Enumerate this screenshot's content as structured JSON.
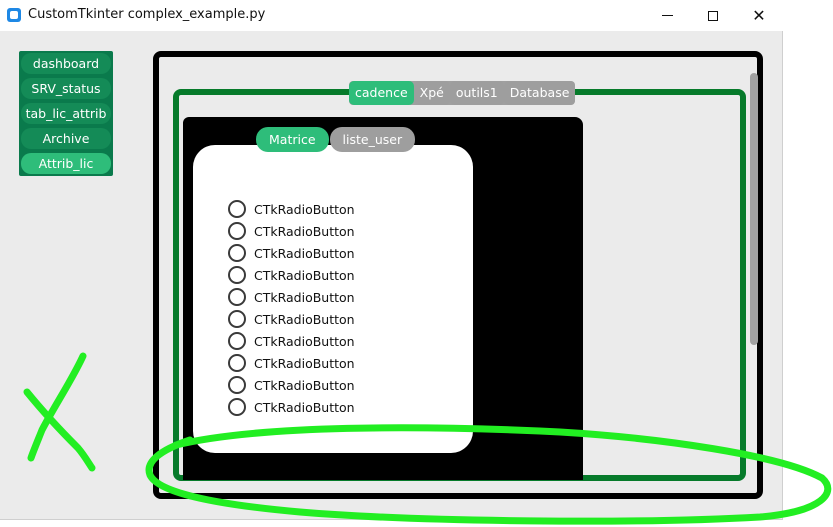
{
  "window": {
    "title": "CustomTkinter complex_example.py"
  },
  "sidebar": {
    "items": [
      {
        "label": "dashboard",
        "active": false
      },
      {
        "label": "SRV_status",
        "active": false
      },
      {
        "label": "tab_lic_attrib",
        "active": false
      },
      {
        "label": "Archive",
        "active": false
      },
      {
        "label": "Attrib_lic",
        "active": true
      }
    ]
  },
  "main_tabs": [
    {
      "label": "cadence",
      "active": true
    },
    {
      "label": "Xpé",
      "active": false
    },
    {
      "label": "outils1",
      "active": false
    },
    {
      "label": "Database",
      "active": false
    }
  ],
  "sub_tabs": [
    {
      "label": "Matrice",
      "active": true
    },
    {
      "label": "liste_user",
      "active": false
    }
  ],
  "radio_buttons": [
    {
      "label": "CTkRadioButton"
    },
    {
      "label": "CTkRadioButton"
    },
    {
      "label": "CTkRadioButton"
    },
    {
      "label": "CTkRadioButton"
    },
    {
      "label": "CTkRadioButton"
    },
    {
      "label": "CTkRadioButton"
    },
    {
      "label": "CTkRadioButton"
    },
    {
      "label": "CTkRadioButton"
    },
    {
      "label": "CTkRadioButton"
    },
    {
      "label": "CTkRadioButton"
    }
  ],
  "colors": {
    "accent_green": "#2ebd7a",
    "sidebar_green": "#0a7a4c",
    "frame_green": "#067a2a",
    "annotation_green": "#22ee22",
    "inactive_tab": "#9e9e9e"
  },
  "icons": {
    "app": "customtkinter-app-icon",
    "minimize": "minimize-icon",
    "maximize": "maximize-icon",
    "close": "close-icon"
  }
}
